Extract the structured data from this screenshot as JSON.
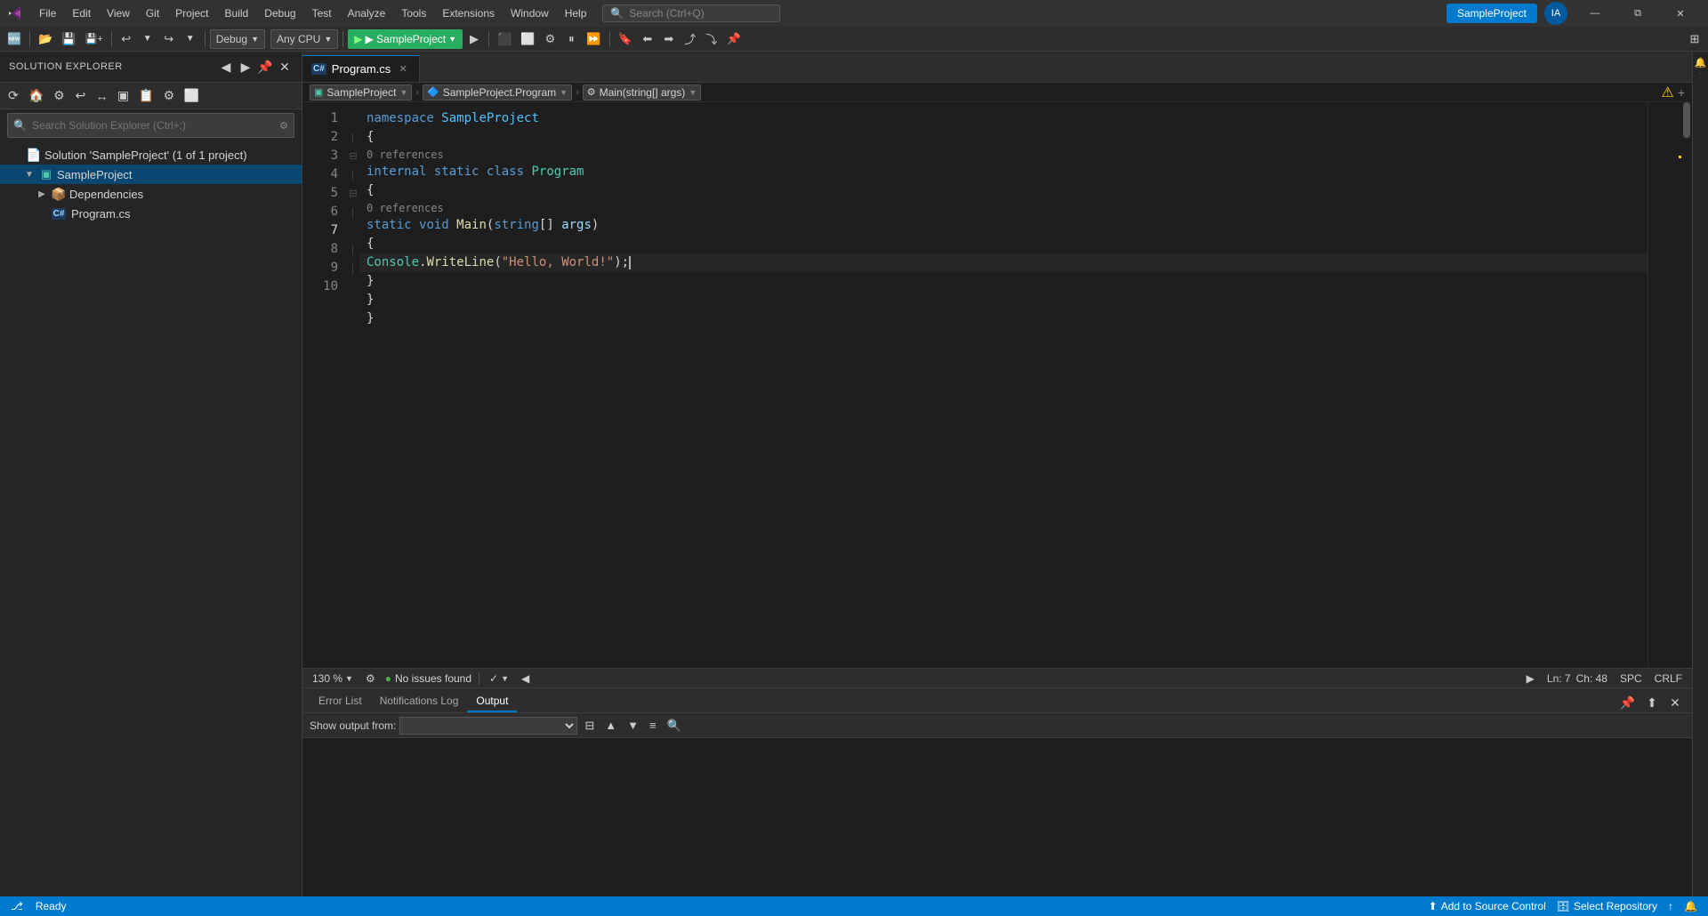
{
  "titlebar": {
    "logo": "⬡",
    "menu_items": [
      "File",
      "Edit",
      "View",
      "Git",
      "Project",
      "Build",
      "Debug",
      "Test",
      "Analyze",
      "Tools",
      "Extensions",
      "Window",
      "Help"
    ],
    "search_placeholder": "Search (Ctrl+Q)",
    "search_icon": "🔍",
    "project_name": "SampleProject",
    "user_icon": "IA",
    "minimize_label": "—",
    "restore_label": "⧉",
    "close_label": "✕"
  },
  "toolbar": {
    "buttons": [
      "↩",
      "⬅",
      "➡"
    ],
    "config_label": "Debug",
    "platform_label": "Any CPU",
    "run_label": "▶ SampleProject",
    "debug_label": "▶"
  },
  "sidebar": {
    "title": "Solution Explorer",
    "search_placeholder": "Search Solution Explorer (Ctrl+;)",
    "tree": [
      {
        "id": "solution",
        "level": 0,
        "icon": "📄",
        "label": "Solution 'SampleProject' (1 of 1 project)",
        "arrow": "",
        "expanded": true
      },
      {
        "id": "project",
        "level": 1,
        "icon": "▣",
        "label": "SampleProject",
        "arrow": "▼",
        "expanded": true,
        "selected": true
      },
      {
        "id": "dependencies",
        "level": 2,
        "icon": "📦",
        "label": "Dependencies",
        "arrow": "▶",
        "expanded": false
      },
      {
        "id": "programcs",
        "level": 2,
        "icon": "C#",
        "label": "Program.cs",
        "arrow": "",
        "expanded": false
      }
    ]
  },
  "editor": {
    "tab_label": "Program.cs",
    "tab_modified": false,
    "breadcrumb": {
      "project": "SampleProject",
      "namespace": "SampleProject.Program",
      "method": "Main(string[] args)"
    },
    "lines": [
      {
        "num": 1,
        "tokens": [
          {
            "t": "namespace",
            "c": "kw"
          },
          {
            "t": " ",
            "c": ""
          },
          {
            "t": "SampleProject",
            "c": "ns"
          }
        ]
      },
      {
        "num": 2,
        "tokens": [
          {
            "t": "{",
            "c": "punct"
          }
        ]
      },
      {
        "num": 3,
        "ref": "0 references",
        "tokens": [
          {
            "t": "    internal",
            "c": "kw"
          },
          {
            "t": " ",
            "c": ""
          },
          {
            "t": "static",
            "c": "kw"
          },
          {
            "t": " ",
            "c": ""
          },
          {
            "t": "class",
            "c": "kw"
          },
          {
            "t": " ",
            "c": ""
          },
          {
            "t": "Program",
            "c": "cls"
          }
        ]
      },
      {
        "num": 4,
        "tokens": [
          {
            "t": "    {",
            "c": "punct"
          }
        ]
      },
      {
        "num": 5,
        "ref": "0 references",
        "tokens": [
          {
            "t": "        static",
            "c": "kw"
          },
          {
            "t": " ",
            "c": ""
          },
          {
            "t": "void",
            "c": "kw"
          },
          {
            "t": " ",
            "c": ""
          },
          {
            "t": "Main",
            "c": "fn"
          },
          {
            "t": "(",
            "c": "punct"
          },
          {
            "t": "string",
            "c": "kw"
          },
          {
            "t": "[] ",
            "c": ""
          },
          {
            "t": "args",
            "c": "param"
          },
          {
            "t": ")",
            "c": "punct"
          }
        ]
      },
      {
        "num": 6,
        "tokens": [
          {
            "t": "        {",
            "c": "punct"
          }
        ]
      },
      {
        "num": 7,
        "tokens": [
          {
            "t": "            Console",
            "c": "cls"
          },
          {
            "t": ".",
            "c": "punct"
          },
          {
            "t": "WriteLine",
            "c": "fn"
          },
          {
            "t": "(",
            "c": "punct"
          },
          {
            "t": "\"Hello, ",
            "c": "str"
          },
          {
            "t": "World!",
            "c": "str"
          },
          {
            "t": "\"",
            "c": "str"
          },
          {
            "t": ");",
            "c": "punct"
          }
        ],
        "cursor": true
      },
      {
        "num": 8,
        "tokens": [
          {
            "t": "        }",
            "c": "punct"
          }
        ]
      },
      {
        "num": 9,
        "tokens": [
          {
            "t": "    }",
            "c": "punct"
          }
        ]
      },
      {
        "num": 10,
        "tokens": [
          {
            "t": "}",
            "c": "punct"
          }
        ]
      }
    ],
    "zoom": "130 %",
    "status_icon": "⚙",
    "no_issues": "No issues found",
    "position": "Ln: 7",
    "col": "Ch: 48",
    "encoding": "SPC",
    "line_ending": "CRLF"
  },
  "output_panel": {
    "tabs": [
      "Error List",
      "Notifications Log",
      "Output"
    ],
    "active_tab": "Output",
    "show_output_from_label": "Show output from:",
    "show_output_from_placeholder": ""
  },
  "statusbar": {
    "ready_label": "Ready",
    "add_to_source": "Add to Source Control",
    "select_repository": "Select Repository",
    "notifications_icon": "🔔",
    "live_share_icon": "↑"
  }
}
